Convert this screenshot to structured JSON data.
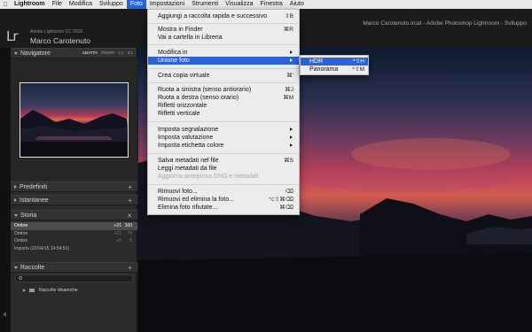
{
  "menubar": {
    "apple_icon": "apple-logo-icon",
    "items": [
      "Lightroom",
      "File",
      "Modifica",
      "Sviluppo",
      "Foto",
      "Impostazioni",
      "Strumenti",
      "Visualizza",
      "Finestra",
      "Aiuto"
    ],
    "active": "Foto",
    "window_title": "Marco Carotenuto.lrcat - Adobe Photoshop Lightroom - Sviluppo"
  },
  "identity": {
    "logo": "Lr",
    "product": "Adobe Lightroom CC 2015",
    "user": "Marco Carotenuto"
  },
  "navigator": {
    "title": "Navigatore",
    "zoom_options": [
      "ADATTA",
      "RIEMPI",
      "1:1",
      "3:1"
    ],
    "selected_zoom": "ADATTA"
  },
  "panels": {
    "presets": "Predefiniti",
    "snapshots": "Istantanee",
    "history": "Storia",
    "collections": "Raccolte"
  },
  "history": {
    "rows": [
      {
        "label": "Ombre",
        "v1": "+21",
        "v2": "100",
        "selected": true
      },
      {
        "label": "Ombre",
        "v1": "+21",
        "v2": "79",
        "selected": false
      },
      {
        "label": "Ombre",
        "v1": "+5",
        "v2": "5",
        "selected": false
      },
      {
        "label": "Importa (22/04/15 14:54:51)",
        "v1": "",
        "v2": "",
        "selected": false
      }
    ],
    "clear_icon": "close-icon"
  },
  "collections": {
    "search_icon": "search-icon",
    "item": "Raccolte dinamiche"
  },
  "photo_menu": {
    "items": [
      {
        "label": "Aggiungi a raccolta rapida e successivo",
        "shortcut": "⇧B"
      },
      {
        "label": "Mostra in Finder",
        "shortcut": "⌘R"
      },
      {
        "label": "Vai a cartella in Libreria",
        "shortcut": ""
      },
      {
        "label": "Modifica in",
        "shortcut": "",
        "submenu": true
      },
      {
        "label": "Unione foto",
        "shortcut": "",
        "submenu": true,
        "highlighted": true
      },
      {
        "label": "Crea copia virtuale",
        "shortcut": "⌘'"
      },
      {
        "label": "Ruota a sinistra (senso antiorario)",
        "shortcut": "⌘J"
      },
      {
        "label": "Ruota a destra (senso orario)",
        "shortcut": "⌘M"
      },
      {
        "label": "Rifletti orizzontale",
        "shortcut": ""
      },
      {
        "label": "Rifletti verticale",
        "shortcut": ""
      },
      {
        "label": "Imposta segnalazione",
        "shortcut": "",
        "submenu": true
      },
      {
        "label": "Imposta valutazione",
        "shortcut": "",
        "submenu": true
      },
      {
        "label": "Imposta etichetta colore",
        "shortcut": "",
        "submenu": true
      },
      {
        "label": "Salva metadati nel file",
        "shortcut": "⌘S"
      },
      {
        "label": "Leggi metadati da file",
        "shortcut": ""
      },
      {
        "label": "Aggiorna anteprima DNG e metadati",
        "shortcut": "",
        "disabled": true
      },
      {
        "label": "Rimuovi foto...",
        "shortcut": "⌫"
      },
      {
        "label": "Rimuovi ed elimina la foto...",
        "shortcut": "⌥⇧⌘⌫"
      },
      {
        "label": "Elimina foto rifiutate...",
        "shortcut": "⌘⌫"
      }
    ]
  },
  "merge_submenu": {
    "items": [
      {
        "label": "HDR",
        "shortcut": "^⇧H",
        "highlighted": true
      },
      {
        "label": "Panorama",
        "shortcut": "^⇧M"
      }
    ]
  },
  "colors": {
    "accent": "#2a62d9",
    "panel": "#2b2b2b",
    "menu_bg": "#ececec"
  }
}
